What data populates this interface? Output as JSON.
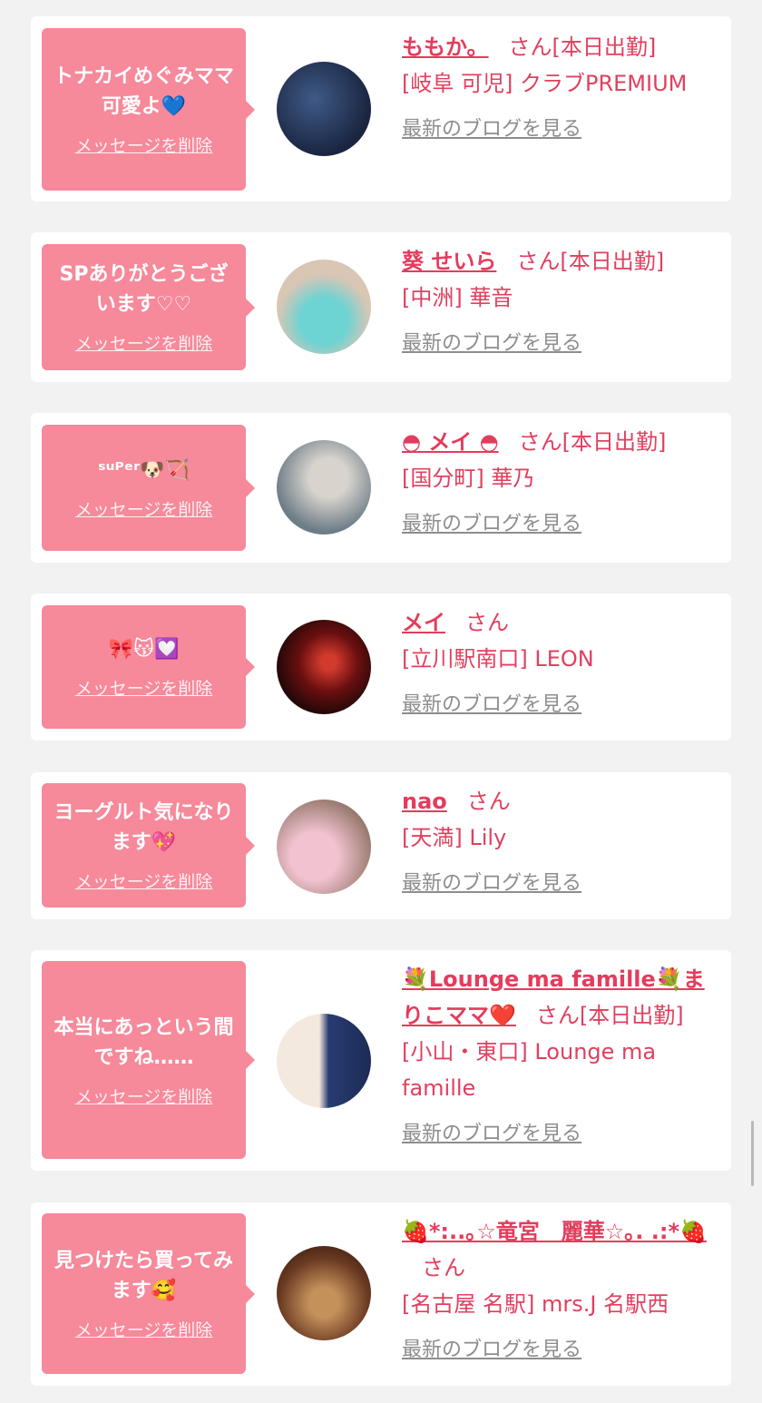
{
  "actions": {
    "delete_message": "メッセージを削除",
    "view_blog": "最新のブログを見る"
  },
  "suffix": {
    "san": "さん",
    "shukkin": "[本日出勤]"
  },
  "messages": [
    {
      "text": "トナカイめぐみママ可愛よ💙",
      "name": "ももか。",
      "store": "[岐阜 可児] クラブPREMIUM",
      "on_duty": true,
      "avatar_colors": [
        "#1a2540",
        "#3f5a86"
      ]
    },
    {
      "text": "SPありがとうございます♡♡",
      "name": "葵 せいら",
      "store": "[中洲] 華音",
      "on_duty": true,
      "avatar_colors": [
        "#6dd3d3",
        "#d9c6b5"
      ]
    },
    {
      "text": "ˢᵘᴾᵉʳ🐶🏹",
      "name": "◓ メイ ◓",
      "store": "[国分町] 華乃",
      "on_duty": true,
      "avatar_colors": [
        "#6d7d88",
        "#d8d4cd"
      ]
    },
    {
      "text": "🎀😽💟",
      "name": "メイ",
      "store": "[立川駅南口] LEON",
      "on_duty": false,
      "avatar_colors": [
        "#6b0f10",
        "#d23a2c"
      ]
    },
    {
      "text": "ヨーグルト気になります💖",
      "name": "nao",
      "store": "[天満] Lily",
      "on_duty": false,
      "avatar_colors": [
        "#f1c2cf",
        "#8a6f60"
      ]
    },
    {
      "text": "本当にあっという間ですね……",
      "name": "💐Lounge ma famille💐まりこママ❤️",
      "store": "[小山・東口] Lounge ma famille",
      "on_duty": true,
      "avatar_colors": [
        "#f3e9df",
        "#283c74"
      ]
    },
    {
      "text": "見つけたら買ってみます🥰",
      "name": "🍓*:..｡☆竜宮　麗華☆｡. .:*🍓",
      "store": "[名古屋 名駅] mrs.J 名駅西",
      "on_duty": false,
      "avatar_colors": [
        "#6b3a22",
        "#c4915b"
      ]
    }
  ]
}
